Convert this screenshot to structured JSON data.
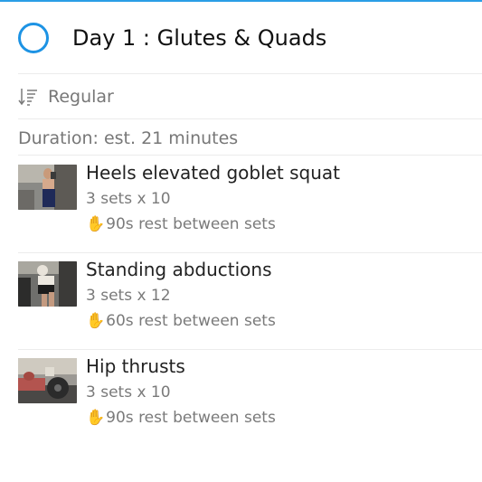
{
  "header": {
    "title": "Day 1 : Glutes & Quads",
    "accent": "#1d93e4"
  },
  "sort": {
    "label": "Regular",
    "icon": "sort-descending-icon"
  },
  "duration": "Duration: est. 21 minutes",
  "exercises": [
    {
      "name": "Heels elevated goblet squat",
      "sets": "3 sets x 10",
      "rest_icon": "✋",
      "rest": "90s rest between sets",
      "thumb": "gym-photo"
    },
    {
      "name": "Standing abductions",
      "sets": "3 sets x 12",
      "rest_icon": "✋",
      "rest": "60s rest between sets",
      "thumb": "gym-photo"
    },
    {
      "name": "Hip thrusts",
      "sets": "3 sets x 10",
      "rest_icon": "✋",
      "rest": "90s rest between sets",
      "thumb": "gym-photo"
    }
  ]
}
